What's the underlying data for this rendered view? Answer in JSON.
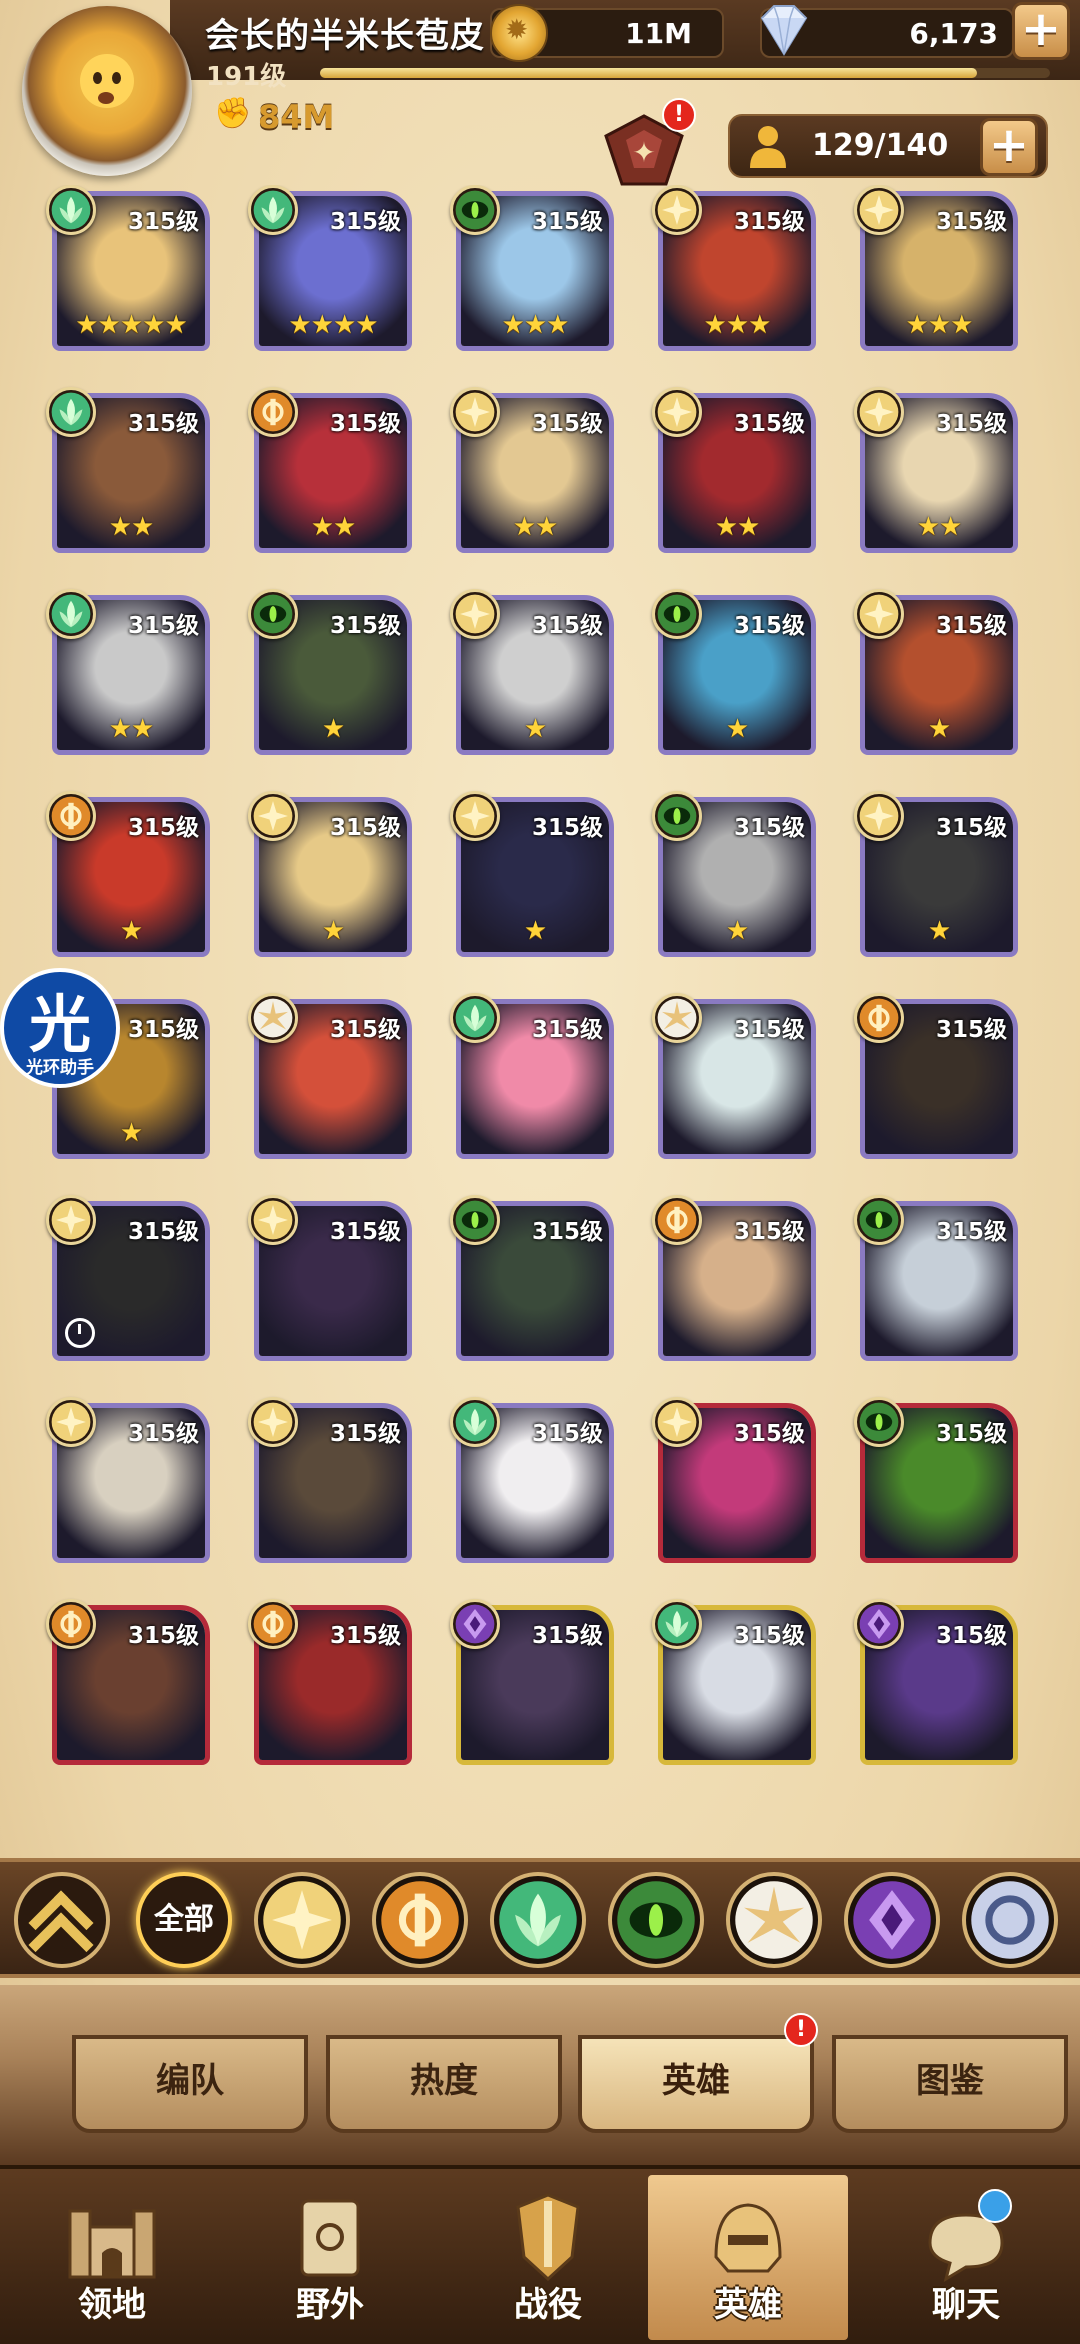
{
  "player": {
    "name": "会长的半米长苞皮",
    "level": "191级",
    "level_progress": 0.9,
    "power": "84M",
    "avatar_icon": "chick-avatar-icon"
  },
  "resources": {
    "gold": "11M",
    "gems": "6,173",
    "add": "+"
  },
  "hero_capacity": "129/140",
  "event_badge": "!",
  "heroes": [
    {
      "level": "315级",
      "stars": "★★★★★",
      "faction": "wilder",
      "frame": "normal",
      "hue": "#e8c37a"
    },
    {
      "level": "315级",
      "stars": "★★★★",
      "faction": "wilder",
      "frame": "normal",
      "hue": "#6c6fd0"
    },
    {
      "level": "315级",
      "stars": "★★★",
      "faction": "graveborn",
      "frame": "normal",
      "hue": "#9cc7e8"
    },
    {
      "level": "315级",
      "stars": "★★★",
      "faction": "lightbearer",
      "frame": "normal",
      "hue": "#c0452e"
    },
    {
      "level": "315级",
      "stars": "★★★",
      "faction": "lightbearer",
      "frame": "normal",
      "hue": "#d6b26a"
    },
    {
      "level": "315级",
      "stars": "★★",
      "faction": "wilder",
      "frame": "normal",
      "hue": "#8a5a3a"
    },
    {
      "level": "315级",
      "stars": "★★",
      "faction": "mauler",
      "frame": "normal",
      "hue": "#b7303a"
    },
    {
      "level": "315级",
      "stars": "★★",
      "faction": "lightbearer",
      "frame": "normal",
      "hue": "#e3c892"
    },
    {
      "level": "315级",
      "stars": "★★",
      "faction": "lightbearer",
      "frame": "normal",
      "hue": "#a22a2e"
    },
    {
      "level": "315级",
      "stars": "★★",
      "faction": "lightbearer",
      "frame": "normal",
      "hue": "#e8d6b0"
    },
    {
      "level": "315级",
      "stars": "★★",
      "faction": "wilder",
      "frame": "normal",
      "hue": "#c9c9c9"
    },
    {
      "level": "315级",
      "stars": "★",
      "faction": "graveborn",
      "frame": "normal",
      "hue": "#4a5a3a"
    },
    {
      "level": "315级",
      "stars": "★",
      "faction": "lightbearer",
      "frame": "normal",
      "hue": "#cfcfcf"
    },
    {
      "level": "315级",
      "stars": "★",
      "faction": "graveborn",
      "frame": "normal",
      "hue": "#4aa0c8"
    },
    {
      "level": "315级",
      "stars": "★",
      "faction": "lightbearer",
      "frame": "normal",
      "hue": "#b4502e"
    },
    {
      "level": "315级",
      "stars": "★",
      "faction": "mauler",
      "frame": "normal",
      "hue": "#c93a2a"
    },
    {
      "level": "315级",
      "stars": "★",
      "faction": "lightbearer",
      "frame": "normal",
      "hue": "#e6c987"
    },
    {
      "level": "315级",
      "stars": "★",
      "faction": "lightbearer",
      "frame": "normal",
      "hue": "#2a2a4a"
    },
    {
      "level": "315级",
      "stars": "★",
      "faction": "graveborn",
      "frame": "normal",
      "hue": "#b0b0b0"
    },
    {
      "level": "315级",
      "stars": "★",
      "faction": "lightbearer",
      "frame": "normal",
      "hue": "#3a3a3a"
    },
    {
      "level": "315级",
      "stars": "★",
      "faction": "mauler",
      "frame": "normal",
      "hue": "#b8862e"
    },
    {
      "level": "315级",
      "stars": "",
      "faction": "celestial",
      "frame": "normal",
      "hue": "#d4503a"
    },
    {
      "level": "315级",
      "stars": "",
      "faction": "wilder",
      "frame": "normal",
      "hue": "#f08aa8"
    },
    {
      "level": "315级",
      "stars": "",
      "faction": "celestial",
      "frame": "normal",
      "hue": "#d8e6e6"
    },
    {
      "level": "315级",
      "stars": "",
      "faction": "mauler",
      "frame": "normal",
      "hue": "#3a3028"
    },
    {
      "level": "315级",
      "stars": "",
      "faction": "lightbearer",
      "frame": "normal",
      "hue": "#2a2a2a",
      "clock": true
    },
    {
      "level": "315级",
      "stars": "",
      "faction": "lightbearer",
      "frame": "normal",
      "hue": "#3a2a4a"
    },
    {
      "level": "315级",
      "stars": "",
      "faction": "graveborn",
      "frame": "normal",
      "hue": "#3a4a3a"
    },
    {
      "level": "315级",
      "stars": "",
      "faction": "mauler",
      "frame": "normal",
      "hue": "#d6b08a"
    },
    {
      "level": "315级",
      "stars": "",
      "faction": "graveborn",
      "frame": "normal",
      "hue": "#c6cfd8"
    },
    {
      "level": "315级",
      "stars": "",
      "faction": "lightbearer",
      "frame": "normal",
      "hue": "#d8d0c0"
    },
    {
      "level": "315级",
      "stars": "",
      "faction": "lightbearer",
      "frame": "normal",
      "hue": "#5a4a3a"
    },
    {
      "level": "315级",
      "stars": "",
      "faction": "wilder",
      "frame": "normal",
      "hue": "#f0eef0"
    },
    {
      "level": "315级",
      "stars": "",
      "faction": "lightbearer",
      "frame": "cursed",
      "hue": "#c33a7a"
    },
    {
      "level": "315级",
      "stars": "",
      "faction": "graveborn",
      "frame": "cursed",
      "hue": "#4a8a2a"
    },
    {
      "level": "315级",
      "stars": "",
      "faction": "mauler",
      "frame": "cursed",
      "hue": "#6a4030"
    },
    {
      "level": "315级",
      "stars": "",
      "faction": "mauler",
      "frame": "cursed",
      "hue": "#9a2a2a"
    },
    {
      "level": "315级",
      "stars": "",
      "faction": "hypogean",
      "frame": "ascended",
      "hue": "#4a3a5a"
    },
    {
      "level": "315级",
      "stars": "",
      "faction": "wilder",
      "frame": "ascended",
      "hue": "#d8dce4"
    },
    {
      "level": "315级",
      "stars": "",
      "faction": "hypogean",
      "frame": "ascended",
      "hue": "#5a3a8a"
    }
  ],
  "faction_colors": {
    "lightbearer": "#f0d27a",
    "mauler": "#e08a2a",
    "wilder": "#43b87a",
    "graveborn": "#3c8a3a",
    "celestial": "#f3efe4",
    "hypogean": "#7a3fb3",
    "dimensional": "#c8d0e8"
  },
  "halo_assistant": {
    "char": "光",
    "label": "光环助手"
  },
  "filters": {
    "collapse_icon": "chevron-up-icon",
    "all_label": "全部",
    "items": [
      "lightbearer-icon",
      "mauler-icon",
      "wilder-icon",
      "graveborn-icon",
      "celestial-icon",
      "hypogean-icon",
      "dimensional-icon"
    ]
  },
  "tabs": [
    {
      "label": "编队",
      "active": false
    },
    {
      "label": "热度",
      "active": false
    },
    {
      "label": "英雄",
      "active": true,
      "badge": "!"
    },
    {
      "label": "图鉴",
      "active": false
    }
  ],
  "bottom_nav": [
    {
      "label": "领地",
      "icon": "castle-icon",
      "active": false
    },
    {
      "label": "野外",
      "icon": "scroll-map-icon",
      "active": false
    },
    {
      "label": "战役",
      "icon": "sword-shield-icon",
      "active": false
    },
    {
      "label": "英雄",
      "icon": "helmet-icon",
      "active": true
    },
    {
      "label": "聊天",
      "icon": "chat-bubble-icon",
      "active": false
    }
  ]
}
